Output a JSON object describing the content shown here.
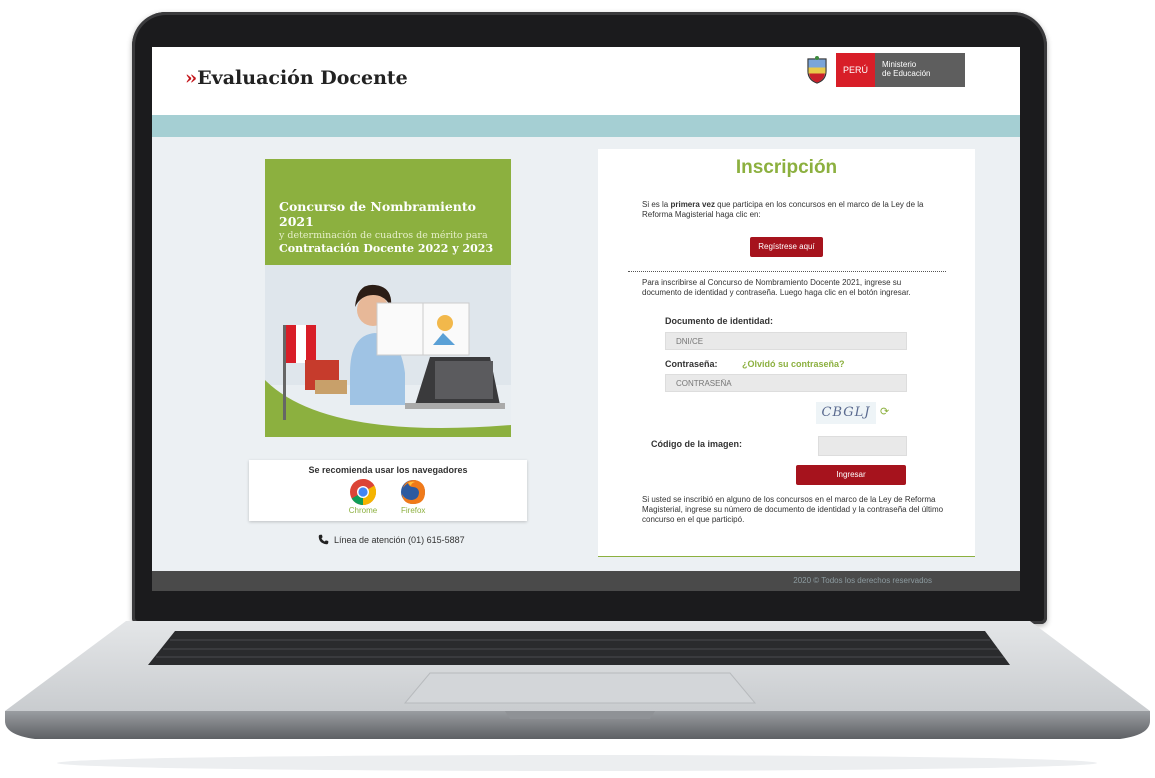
{
  "header": {
    "logo_chevrons": "››",
    "logo_text": "Evaluación Docente",
    "gov_country": "PERÚ",
    "gov_ministry_1": "Ministerio",
    "gov_ministry_2": "de Educación"
  },
  "promo": {
    "line1": "Concurso de Nombramiento 2021",
    "line2": "y determinación de cuadros de mérito para",
    "line3": "Contratación Docente 2022 y 2023"
  },
  "browsers": {
    "title": "Se recomienda usar los navegadores",
    "items": [
      {
        "label": "Chrome",
        "icon": "chrome-icon"
      },
      {
        "label": "Firefox",
        "icon": "firefox-icon"
      }
    ]
  },
  "support": {
    "phone_label": "Línea de atención (01) 615-5887"
  },
  "form": {
    "title": "Inscripción",
    "intro_pre": "Si es la ",
    "intro_bold": "primera vez",
    "intro_post": " que participa en los concursos en el marco de la Ley de la Reforma Magisterial haga clic en:",
    "register_button": "Regístrese aquí",
    "instructions": "Para inscribirse al Concurso de Nombramiento Docente 2021, ingrese su documento de identidad y contraseña. Luego haga clic en el botón ingresar.",
    "doc_label": "Documento de identidad:",
    "doc_placeholder": "DNI/CE",
    "password_label": "Contraseña:",
    "forgot_link": "¿Olvidó su contraseña?",
    "password_placeholder": "CONTRASEÑA",
    "captcha_text": "CBGLJ",
    "captcha_label": "Código de la imagen:",
    "submit_button": "Ingresar",
    "note": "Si usted se inscribió en alguno de los concursos en el marco de la Ley de Reforma Magisterial, ingrese su número de documento de identidad y la contraseña del último concurso en el que participó."
  },
  "footer": {
    "copyright": "2020 © Todos los derechos reservados"
  },
  "colors": {
    "accent_green": "#8cb03f",
    "button_red": "#a6131d",
    "teal_bar": "#a5cfd3",
    "footer_bg": "#4a4a4a"
  }
}
